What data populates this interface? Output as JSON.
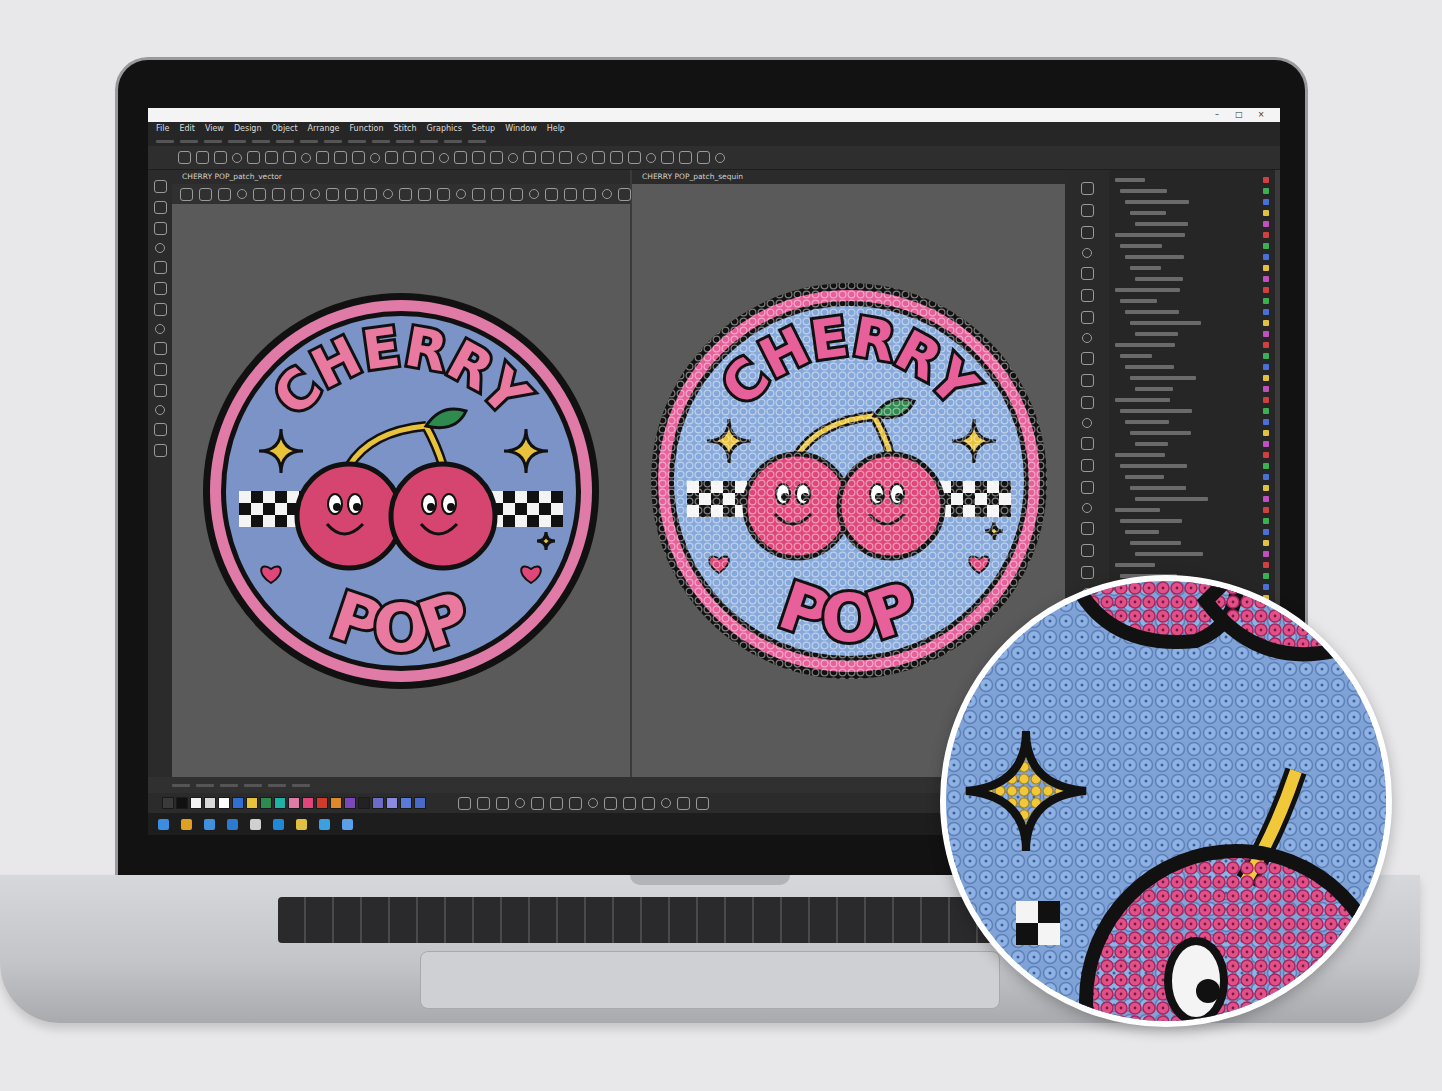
{
  "window": {
    "controls": [
      "–",
      "□",
      "×"
    ]
  },
  "menu": [
    "File",
    "Edit",
    "View",
    "Design",
    "Object",
    "Arrange",
    "Function",
    "Stitch",
    "Graphics",
    "Setup",
    "Window",
    "Help"
  ],
  "documents": [
    {
      "tab": "CHERRY POP_patch_vector",
      "kind": "vector",
      "top_text": "CHERRY",
      "bottom_text": "POP"
    },
    {
      "tab": "CHERRY POP_patch_sequin",
      "kind": "sequin",
      "top_text": "CHERRY",
      "bottom_text": "POP"
    }
  ],
  "palette": [
    {
      "color": "#3a3a3a"
    },
    {
      "color": "#111111"
    },
    {
      "color": "#f2f2f2"
    },
    {
      "color": "#d9d9d9"
    },
    {
      "color": "#ffffff"
    },
    {
      "color": "#2f6fd0"
    },
    {
      "color": "#e8c23a"
    },
    {
      "color": "#2e8a4f"
    },
    {
      "color": "#1fb3a8"
    },
    {
      "color": "#e07aa6"
    },
    {
      "color": "#e0467a"
    },
    {
      "color": "#d23a2a"
    },
    {
      "color": "#e0882a"
    },
    {
      "color": "#7a48b8"
    },
    {
      "color": "#222222"
    },
    {
      "color": "#6c6cc8"
    },
    {
      "color": "#8a8ae0"
    },
    {
      "color": "#5a7ad8"
    },
    {
      "color": "#4a6ac8"
    }
  ]
}
